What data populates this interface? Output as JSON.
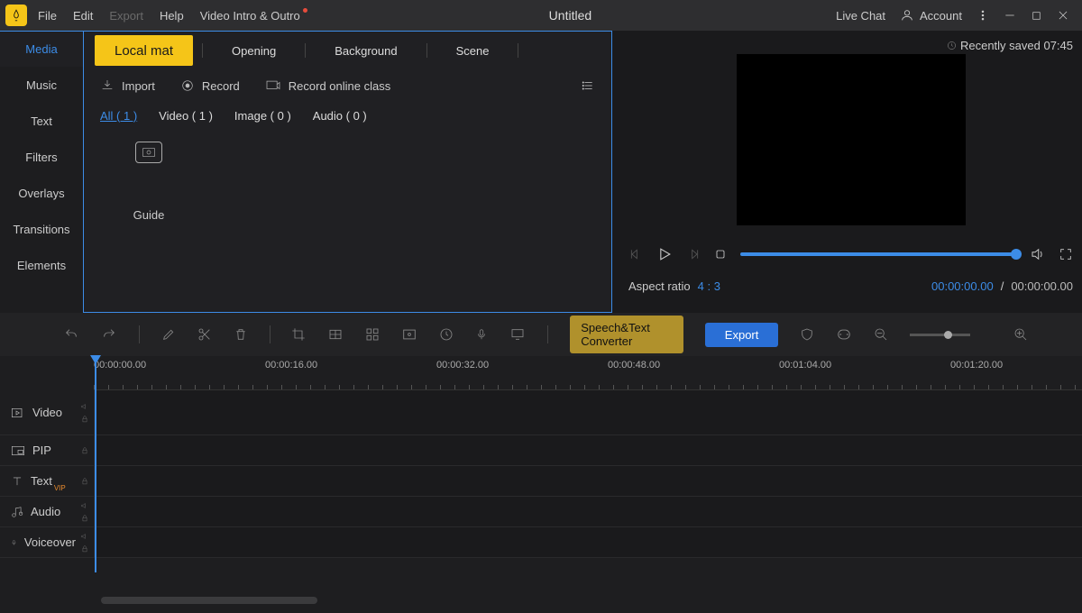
{
  "menubar": {
    "items": [
      "File",
      "Edit",
      "Export",
      "Help",
      "Video Intro & Outro"
    ],
    "disabled_index": 2,
    "dot_index": 4,
    "title": "Untitled",
    "live_chat": "Live Chat",
    "account": "Account",
    "saved": "Recently saved 07:45"
  },
  "sidebar": {
    "tabs": [
      "Media",
      "Music",
      "Text",
      "Filters",
      "Overlays",
      "Transitions",
      "Elements"
    ],
    "active": 0
  },
  "sources": {
    "tabs": [
      "Local mat",
      "Opening",
      "Background",
      "Scene"
    ],
    "active": 0
  },
  "actions": {
    "import": "Import",
    "record": "Record",
    "record_online": "Record online class"
  },
  "filters": {
    "items": [
      "All ( 1 )",
      "Video ( 1 )",
      "Image ( 0 )",
      "Audio ( 0 )"
    ],
    "active": 0
  },
  "thumb": {
    "label": "Guide"
  },
  "preview": {
    "aspect_label": "Aspect ratio",
    "aspect_value": "4 : 3",
    "time_current": "00:00:00.00",
    "time_sep": "/",
    "time_total": "00:00:00.00"
  },
  "toolbar": {
    "speech": "Speech&Text Converter",
    "export": "Export"
  },
  "ruler": {
    "ticks": [
      "00:00:00.00",
      "00:00:16.00",
      "00:00:32.00",
      "00:00:48.00",
      "00:01:04.00",
      "00:01:20.00"
    ]
  },
  "tracks": {
    "video": "Video",
    "pip": "PIP",
    "text": "Text",
    "audio": "Audio",
    "voiceover": "Voiceover"
  }
}
